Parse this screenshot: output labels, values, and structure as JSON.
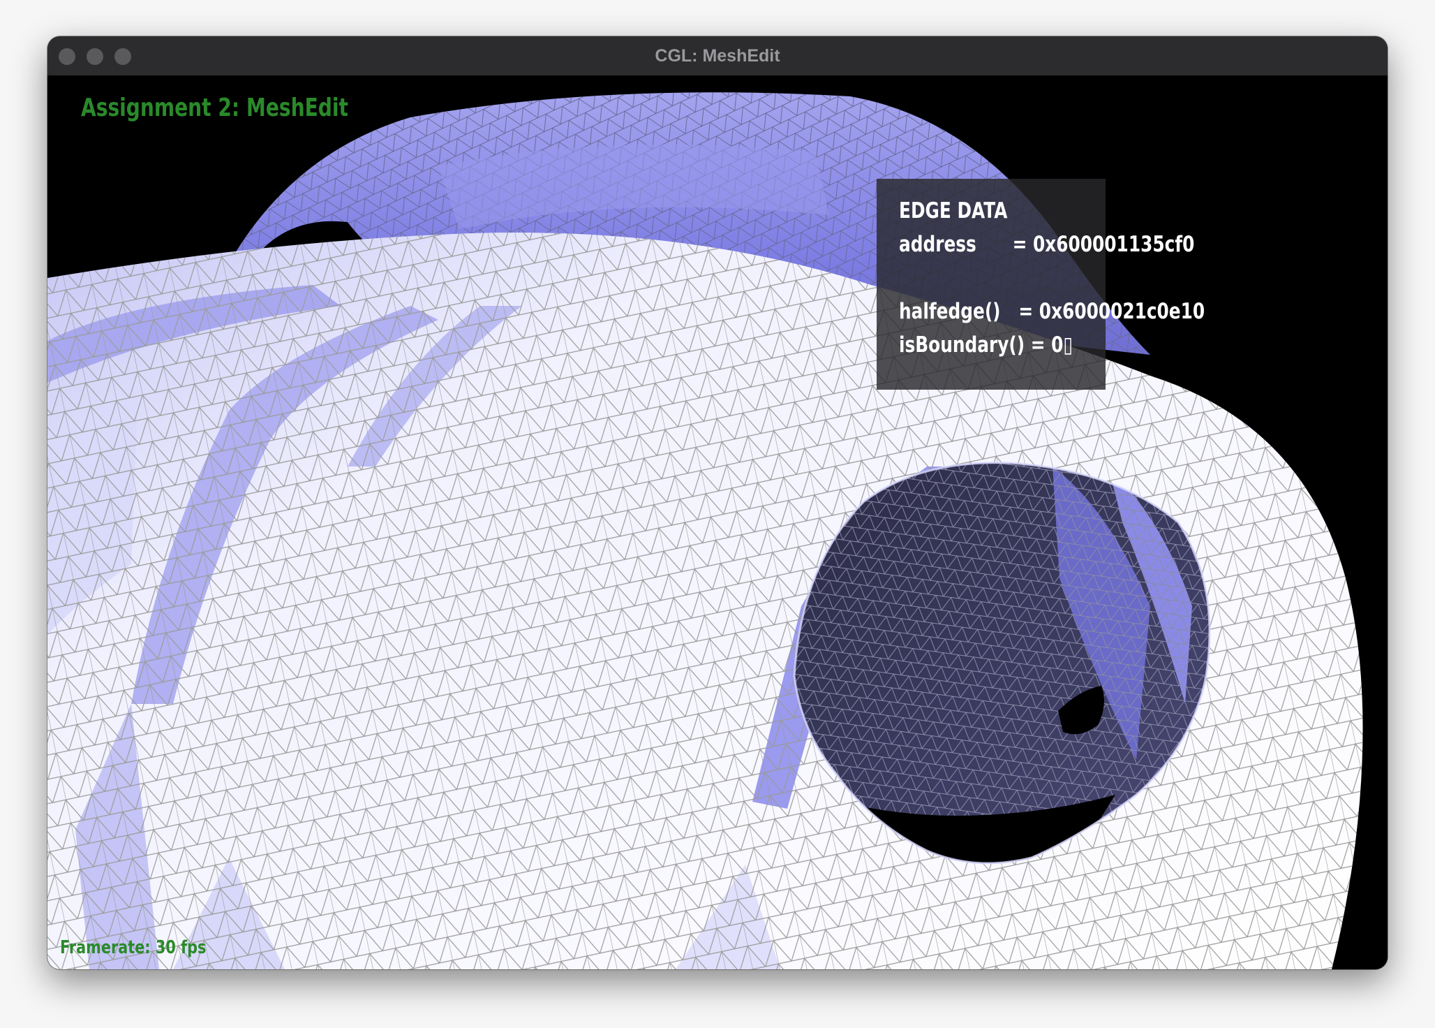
{
  "window": {
    "title": "CGL: MeshEdit"
  },
  "viewport": {
    "heading": "Assignment 2: MeshEdit",
    "framerate": "Framerate: 30 fps",
    "mesh_colors": {
      "light": "#f4f4ff",
      "mid": "#c8c8f4",
      "shade": "#8c8ce8",
      "dark": "#20203a",
      "wire": "#9a9a9a",
      "background": "#000000"
    }
  },
  "edge_data": {
    "title": "EDGE DATA",
    "address": "address      = 0x600001135cf0",
    "halfedge": "halfedge()   = 0x6000021c0e10",
    "is_boundary": "isBoundary() = 0▯"
  }
}
